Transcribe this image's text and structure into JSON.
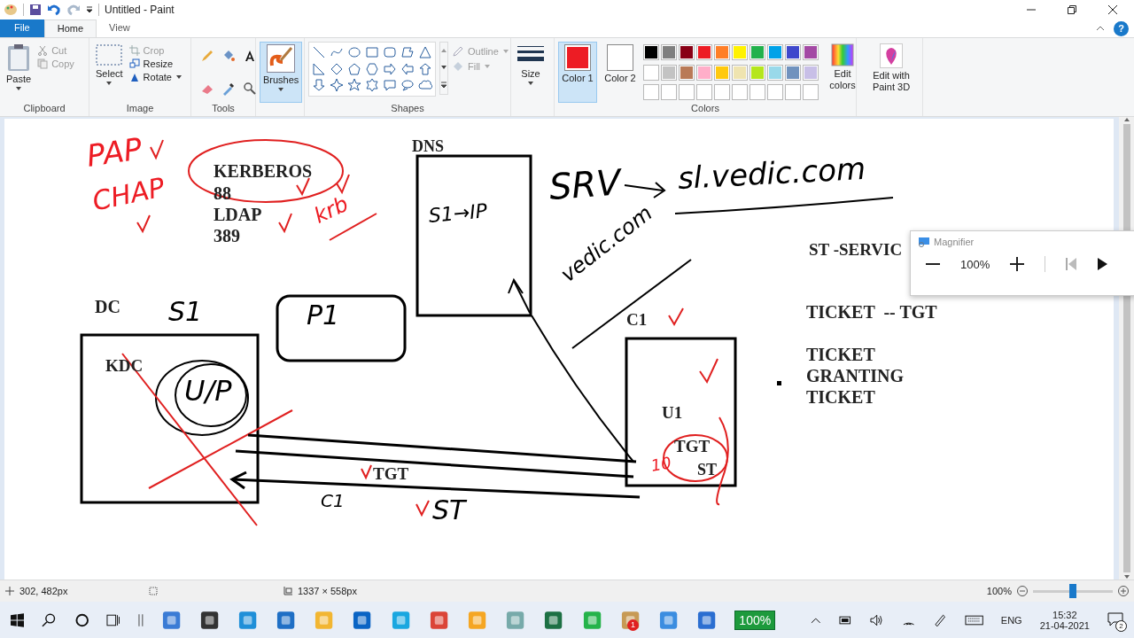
{
  "window": {
    "title": "Untitled - Paint"
  },
  "tabs": [
    {
      "label": "File",
      "selected": false,
      "kind": "menu"
    },
    {
      "label": "Home",
      "selected": true,
      "kind": "tab"
    },
    {
      "label": "View",
      "selected": false,
      "kind": "tab"
    }
  ],
  "help": "?",
  "ribbon": {
    "clipboard": {
      "label": "Clipboard",
      "paste": "Paste",
      "cut": {
        "label": "Cut",
        "disabled": true
      },
      "copy": {
        "label": "Copy",
        "disabled": true
      }
    },
    "image": {
      "label": "Image",
      "select": "Select",
      "crop": {
        "label": "Crop",
        "disabled": true
      },
      "resize": {
        "label": "Resize",
        "disabled": false
      },
      "rotate": {
        "label": "Rotate",
        "disabled": false
      }
    },
    "tools": {
      "label": "Tools"
    },
    "brushes": {
      "label": "Brushes",
      "selected": true
    },
    "shapes": {
      "label": "Shapes",
      "outline": {
        "label": "Outline",
        "disabled": true
      },
      "fill": {
        "label": "Fill",
        "disabled": true
      }
    },
    "size": {
      "label": "Size"
    },
    "colors": {
      "label": "Colors",
      "color1": {
        "label": "Color 1",
        "color": "#ed1c24",
        "selected": true
      },
      "color2": {
        "label": "Color 2",
        "color": "#ffffff",
        "selected": false
      },
      "palette": [
        {
          "color": "#000000"
        },
        {
          "color": "#7f7f7f"
        },
        {
          "color": "#880015"
        },
        {
          "color": "#ed1c24"
        },
        {
          "color": "#ff7f27"
        },
        {
          "color": "#fff200"
        },
        {
          "color": "#22b14c"
        },
        {
          "color": "#00a2e8"
        },
        {
          "color": "#3f48cc"
        },
        {
          "color": "#a349a4"
        },
        {
          "color": "#ffffff"
        },
        {
          "color": "#c3c3c3"
        },
        {
          "color": "#b97a57"
        },
        {
          "color": "#ffaec9"
        },
        {
          "color": "#ffc90e"
        },
        {
          "color": "#efe4b0"
        },
        {
          "color": "#b5e61d"
        },
        {
          "color": "#99d9ea"
        },
        {
          "color": "#7092be"
        },
        {
          "color": "#c8bfe7"
        }
      ],
      "edit_colors": "Edit colors"
    },
    "paint3d": "Edit with Paint 3D"
  },
  "canvas": {
    "typed_texts": [
      "KERBEROS",
      "88",
      "LDAP",
      "389",
      "DNS",
      "DC",
      "KDC",
      "C1",
      "U1",
      "TGT",
      "ST",
      "TGT",
      "ST -SERVIC",
      "TICKET  -- TGT",
      "TICKET\nGRANTING\nTICKET"
    ],
    "handwriting": [
      {
        "text": "PAP",
        "color": "#ed1c24"
      },
      {
        "text": "CHAP",
        "color": "#ed1c24"
      },
      {
        "text": "krb",
        "color": "#ed1c24"
      },
      {
        "text": "SRV",
        "color": "#000000"
      },
      {
        "text": "sl.vedic.com",
        "color": "#000000"
      },
      {
        "text": "vedic.com",
        "color": "#000000"
      },
      {
        "text": "S1→IP",
        "color": "#000000"
      },
      {
        "text": "S1",
        "color": "#000000"
      },
      {
        "text": "P1",
        "color": "#000000"
      },
      {
        "text": "U/P",
        "color": "#000000"
      },
      {
        "text": "C1",
        "color": "#000000"
      },
      {
        "text": "ST",
        "color": "#000000"
      },
      {
        "text": "10",
        "color": "#ed1c24"
      }
    ]
  },
  "magnifier": {
    "title": "Magnifier",
    "zoom": "100%"
  },
  "status_bar": {
    "cursor": "302, 482px",
    "size": "1337 × 558px",
    "zoom": "100%",
    "zoom_slider": {
      "level": 0.5
    }
  },
  "taskbar": {
    "app_badge": "1",
    "battery_badge": "100%",
    "language": "ENG",
    "time": "15:32",
    "date": "21-04-2021",
    "notification_count": "2"
  }
}
